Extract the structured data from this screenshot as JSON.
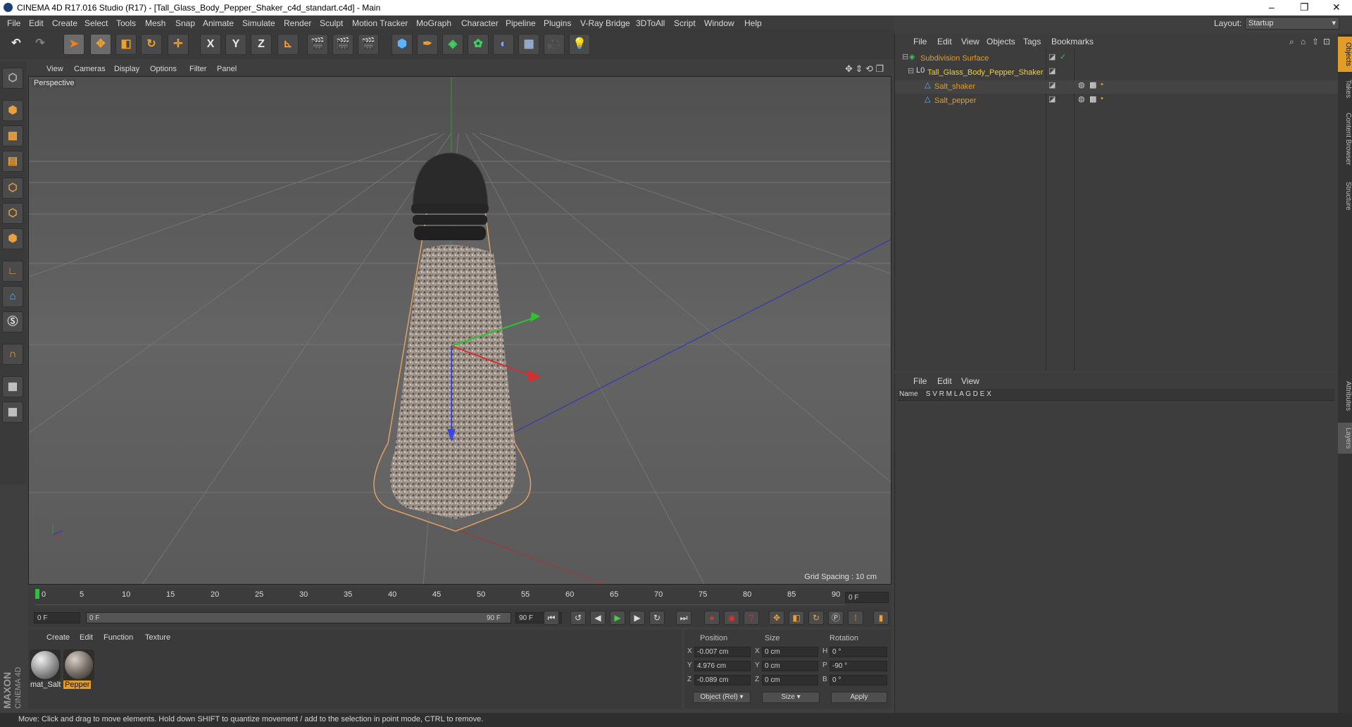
{
  "window": {
    "title": "CINEMA 4D R17.016 Studio (R17) - [Tall_Glass_Body_Pepper_Shaker_c4d_standart.c4d] - Main",
    "min_glyph": "–",
    "max_glyph": "❐",
    "close_glyph": "✕"
  },
  "menu": [
    "File",
    "Edit",
    "Create",
    "Select",
    "Tools",
    "Mesh",
    "Snap",
    "Animate",
    "Simulate",
    "Render",
    "Sculpt",
    "Motion Tracker",
    "MoGraph",
    "Character",
    "Pipeline",
    "Plugins",
    "V-Ray Bridge",
    "3DToAll",
    "Script",
    "Window",
    "Help"
  ],
  "layout": {
    "label": "Layout:",
    "value": "Startup"
  },
  "toolbar": {
    "axis_x": "X",
    "axis_y": "Y",
    "axis_z": "Z"
  },
  "viewport": {
    "menu": [
      "View",
      "Cameras",
      "Display",
      "Options",
      "Filter",
      "Panel"
    ],
    "label": "Perspective",
    "grid_spacing": "Grid Spacing : 10 cm"
  },
  "timeline": {
    "ticks": [
      "0",
      "5",
      "10",
      "15",
      "20",
      "25",
      "30",
      "35",
      "40",
      "45",
      "50",
      "55",
      "60",
      "65",
      "70",
      "75",
      "80",
      "85",
      "90"
    ],
    "current_frame": "0 F",
    "start_field": "0 F",
    "range_start": "0 F",
    "range_end": "90 F",
    "end_field": "90 F"
  },
  "materials": {
    "menu": [
      "Create",
      "Edit",
      "Function",
      "Texture"
    ],
    "items": [
      {
        "name": "mat_Salt",
        "selected": false
      },
      {
        "name": "Pepper",
        "selected": true
      }
    ]
  },
  "coords": {
    "headers": {
      "position": "Position",
      "size": "Size",
      "rotation": "Rotation"
    },
    "rows": [
      {
        "axis": "X",
        "pos": "-0.007 cm",
        "saxis": "X",
        "size": "0 cm",
        "raxis": "H",
        "rot": "0 °"
      },
      {
        "axis": "Y",
        "pos": "4.976 cm",
        "saxis": "Y",
        "size": "0 cm",
        "raxis": "P",
        "rot": "-90 °"
      },
      {
        "axis": "Z",
        "pos": "-0.089 cm",
        "saxis": "Z",
        "size": "0 cm",
        "raxis": "B",
        "rot": "0 °"
      }
    ],
    "mode": "Object (Rel)",
    "size_mode": "Size",
    "apply": "Apply"
  },
  "objects": {
    "menu": [
      "File",
      "Edit",
      "View",
      "Objects",
      "Tags",
      "Bookmarks"
    ],
    "items": [
      {
        "name": "Subdivision Surface"
      },
      {
        "name": "Tall_Glass_Body_Pepper_Shaker"
      },
      {
        "name": "Salt_shaker"
      },
      {
        "name": "Salt_pepper"
      }
    ]
  },
  "layers": {
    "menu": [
      "File",
      "Edit",
      "View"
    ],
    "columns": "Name    S V R M L A G D E X"
  },
  "right_tabs": [
    "Objects",
    "Takes",
    "Content Browser",
    "Structure",
    "Attributes",
    "Layers"
  ],
  "status": "Move: Click and drag to move elements. Hold down SHIFT to quantize movement / add to the selection in point mode, CTRL to remove.",
  "brand": {
    "maxon": "MAXON",
    "c4d": "CINEMA 4D"
  },
  "colors": {
    "accent": "#e29c28",
    "axis_x": "#d03030",
    "axis_y": "#30c030",
    "axis_z": "#3050e0"
  }
}
